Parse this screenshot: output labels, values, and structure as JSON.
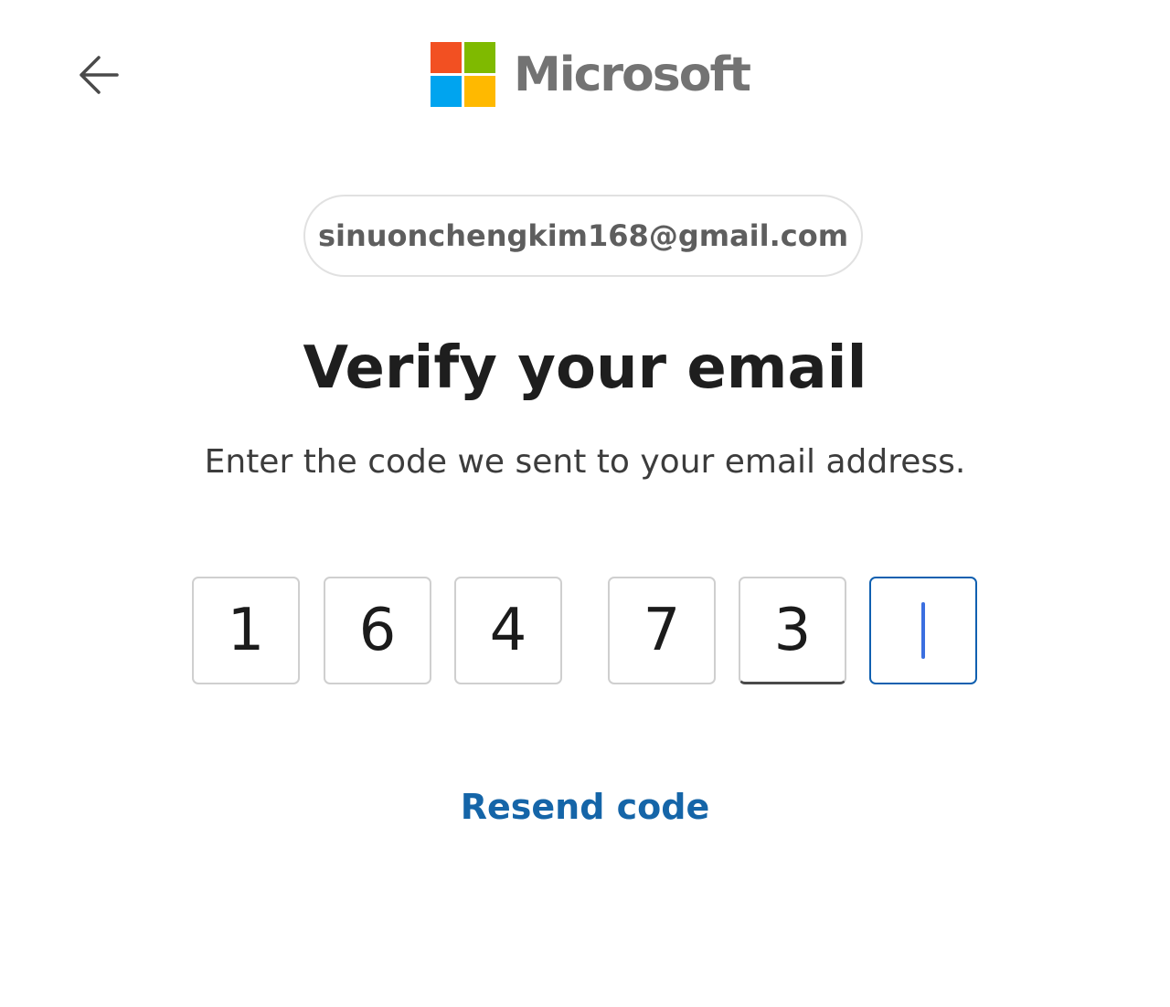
{
  "header": {
    "back_icon": "arrow-left-icon",
    "logo": {
      "text": "Microsoft",
      "colors": [
        "#f25022",
        "#7fba00",
        "#00a4ef",
        "#ffb900"
      ],
      "text_color": "#737373"
    }
  },
  "account": {
    "email": "sinuonchengkim168@gmail.com"
  },
  "main": {
    "title": "Verify your email",
    "subtitle": "Enter the code we sent to your email address.",
    "code": {
      "digits": [
        "1",
        "6",
        "4",
        "7",
        "3",
        ""
      ],
      "focused_index": 5
    },
    "resend_label": "Resend code"
  },
  "colors": {
    "link": "#1565a8",
    "focus_border": "#1060b0",
    "caret": "#3b6fe0"
  }
}
